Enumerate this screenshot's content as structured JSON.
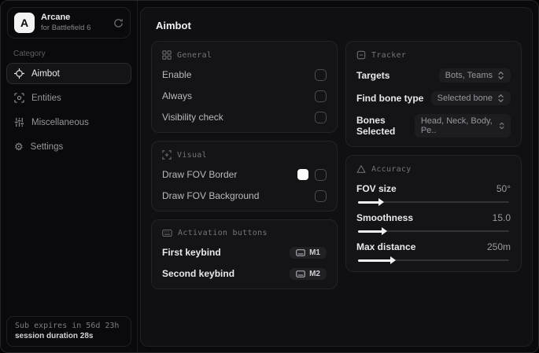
{
  "colors": {
    "window_bg": "#0a0a0c",
    "panel_bg": "#101013",
    "card_bg": "#141417",
    "accent_text": "#ededf0",
    "muted_text": "#97979c",
    "swatch_white": "#ffffff"
  },
  "sidebar": {
    "logo": {
      "letter": "A",
      "title": "Arcane",
      "subtitle": "for Battlefield 6",
      "action_icon": "refresh-icon"
    },
    "category_label": "Category",
    "items": [
      {
        "label": "Aimbot",
        "icon": "crosshair-icon",
        "active": true
      },
      {
        "label": "Entities",
        "icon": "scan-icon",
        "active": false
      },
      {
        "label": "Miscellaneous",
        "icon": "sliders-icon",
        "active": false
      },
      {
        "label": "Settings",
        "icon": "gear-icon",
        "active": false
      }
    ],
    "footer": {
      "line1": "Sub expires in 56d 23h",
      "line2": "session duration 28s"
    }
  },
  "main": {
    "title": "Aimbot",
    "general": {
      "title": "General",
      "icon": "grid-icon",
      "rows": [
        {
          "label": "Enable",
          "checked": false
        },
        {
          "label": "Always",
          "checked": false
        },
        {
          "label": "Visibility check",
          "checked": false
        }
      ]
    },
    "visual": {
      "title": "Visual",
      "icon": "focus-plus-icon",
      "rows": [
        {
          "label": "Draw FOV Border",
          "swatch": "#ffffff",
          "checked": false
        },
        {
          "label": "Draw FOV Background",
          "checked": false
        }
      ]
    },
    "activation": {
      "title": "Activation buttons",
      "icon": "keyboard-icon",
      "rows": [
        {
          "label": "First keybind",
          "key": "M1"
        },
        {
          "label": "Second keybind",
          "key": "M2"
        }
      ]
    },
    "tracker": {
      "title": "Tracker",
      "icon": "box-minus-icon",
      "rows": [
        {
          "label": "Targets",
          "value": "Bots, Teams"
        },
        {
          "label": "Find bone type",
          "value": "Selected bone"
        },
        {
          "label": "Bones Selected",
          "value": "Head, Neck, Body, Pe.."
        }
      ]
    },
    "accuracy": {
      "title": "Accuracy",
      "icon": "triangle-icon",
      "sliders": [
        {
          "label": "FOV size",
          "value": "50°",
          "fill_pct": 14
        },
        {
          "label": "Smoothness",
          "value": "15.0",
          "fill_pct": 16
        },
        {
          "label": "Max distance",
          "value": "250m",
          "fill_pct": 22
        }
      ]
    }
  }
}
